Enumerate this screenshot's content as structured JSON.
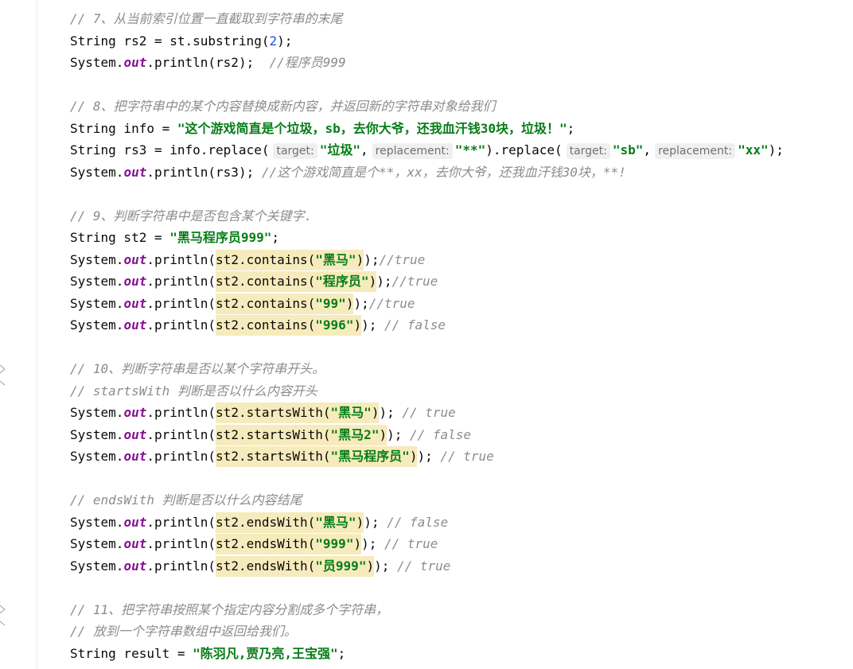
{
  "editor": {
    "l1_comment": "// 7、从当前索引位置一直截取到字符串的末尾",
    "l2_a": "String rs2 = st.substring(",
    "l2_num": "2",
    "l2_b": ");",
    "l3_a": "System.",
    "l3_out": "out",
    "l3_b": ".println(rs2);  ",
    "l3_comment": "//程序员999",
    "l5_comment": "// 8、把字符串中的某个内容替换成新内容，并返回新的字符串对象给我们",
    "l6_a": "String info = ",
    "l6_str": "\"这个游戏简直是个垃圾，sb，去你大爷，还我血汗钱30块，垃圾！\"",
    "l6_b": ";",
    "l7_a": "String rs3 = info.replace(",
    "l7_hint_target": "target:",
    "l7_str1": "\"垃圾\"",
    "l7_comma1": ",",
    "l7_hint_replacement": "replacement:",
    "l7_str2": "\"**\"",
    "l7_b": ").replace(",
    "l7_hint_target2": "target:",
    "l7_str3": "\"sb\"",
    "l7_comma2": ",",
    "l7_hint_replacement2": "replacement:",
    "l7_str4": "\"xx\"",
    "l7_c": ");",
    "l8_a": "System.",
    "l8_out": "out",
    "l8_b": ".println(rs3); ",
    "l8_comment": "//这个游戏简直是个**，xx，去你大爷，还我血汗钱30块，**!",
    "l10_comment": "// 9、判断字符串中是否包含某个关键字.",
    "l11_a": "String st2 = ",
    "l11_str": "\"黑马程序员999\"",
    "l11_b": ";",
    "l12_a": "System.",
    "l12_out": "out",
    "l12_b": ".println(",
    "l12_hl": "st2.contains(",
    "l12_str": "\"黑马\"",
    "l12_hl2": ")",
    "l12_c": ");",
    "l12_comment": "//true",
    "l13_a": "System.",
    "l13_out": "out",
    "l13_b": ".println(",
    "l13_hl": "st2.contains(",
    "l13_str": "\"程序员\"",
    "l13_hl2": ")",
    "l13_c": ");",
    "l13_comment": "//true",
    "l14_a": "System.",
    "l14_out": "out",
    "l14_b": ".println(",
    "l14_hl": "st2.contains(",
    "l14_str": "\"99\"",
    "l14_hl2": ")",
    "l14_c": ");",
    "l14_comment": "//true",
    "l15_a": "System.",
    "l15_out": "out",
    "l15_b": ".println(",
    "l15_hl": "st2.contains(",
    "l15_str": "\"996\"",
    "l15_hl2": ")",
    "l15_c": "); ",
    "l15_comment": "// false",
    "l17_comment": "// 10、判断字符串是否以某个字符串开头。",
    "l18_comment": "// startsWith 判断是否以什么内容开头",
    "l19_a": "System.",
    "l19_out": "out",
    "l19_b": ".println(",
    "l19_hl": "st2.startsWith(",
    "l19_str": "\"黑马\"",
    "l19_hl2": ")",
    "l19_c": "); ",
    "l19_comment": "// true",
    "l20_a": "System.",
    "l20_out": "out",
    "l20_b": ".println(",
    "l20_hl": "st2.startsWith(",
    "l20_str": "\"黑马2\"",
    "l20_hl2": ")",
    "l20_c": "); ",
    "l20_comment": "// false",
    "l21_a": "System.",
    "l21_out": "out",
    "l21_b": ".println(",
    "l21_hl": "st2.startsWith(",
    "l21_str": "\"黑马程序员\"",
    "l21_hl2": ")",
    "l21_c": "); ",
    "l21_comment": "// true",
    "l23_comment": "// endsWith 判断是否以什么内容结尾",
    "l24_a": "System.",
    "l24_out": "out",
    "l24_b": ".println(",
    "l24_hl": "st2.endsWith(",
    "l24_str": "\"黑马\"",
    "l24_hl2": ")",
    "l24_c": "); ",
    "l24_comment": "// false",
    "l25_a": "System.",
    "l25_out": "out",
    "l25_b": ".println(",
    "l25_hl": "st2.endsWith(",
    "l25_str": "\"999\"",
    "l25_hl2": ")",
    "l25_c": "); ",
    "l25_comment": "// true",
    "l26_a": "System.",
    "l26_out": "out",
    "l26_b": ".println(",
    "l26_hl": "st2.endsWith(",
    "l26_str": "\"员999\"",
    "l26_hl2": ")",
    "l26_c": "); ",
    "l26_comment": "// true",
    "l28_comment": "// 11、把字符串按照某个指定内容分割成多个字符串，",
    "l29_comment": "// 放到一个字符串数组中返回给我们。",
    "l30_a": "String result = ",
    "l30_str": "\"陈羽凡,贾乃亮,王宝强\"",
    "l30_b": ";"
  },
  "gutter": {
    "icons": [
      "method-override-marker-icon",
      "method-override-marker-icon"
    ]
  },
  "colors": {
    "comment": "#8c8c8c",
    "string": "#067d17",
    "number": "#1750eb",
    "static_field": "#871094",
    "match_highlight": "#f6ebbc",
    "inlay_hint_bg": "#f0f0f0"
  }
}
